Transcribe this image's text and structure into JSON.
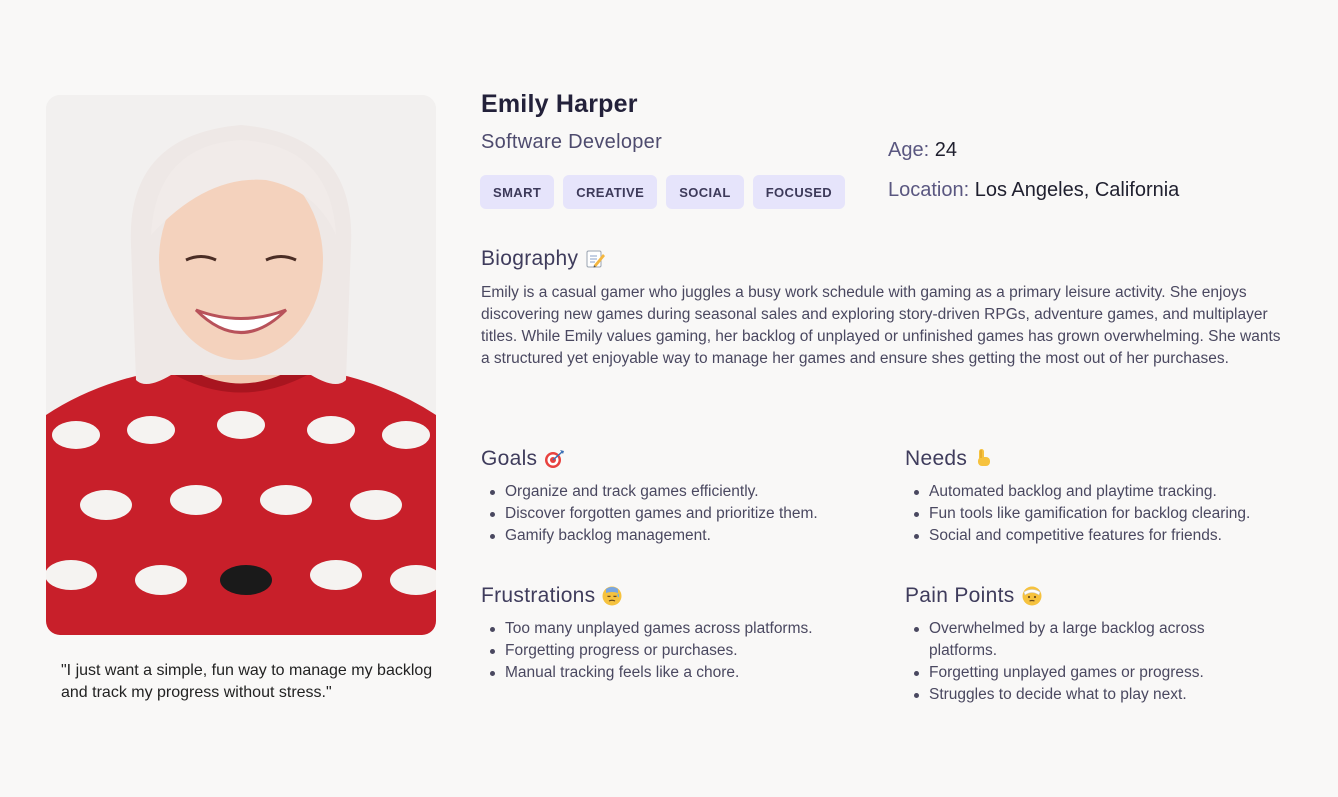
{
  "persona": {
    "name": "Emily Harper",
    "role": "Software Developer",
    "tags": [
      "SMART",
      "CREATIVE",
      "SOCIAL",
      "FOCUSED"
    ],
    "age_label": "Age:",
    "age_value": "24",
    "location_label": "Location:",
    "location_value": "Los Angeles, California",
    "quote": "\"I just want a simple, fun way to manage my backlog and track my progress without stress.\""
  },
  "biography": {
    "title": "Biography",
    "icon": "memo-icon",
    "text": "Emily is a casual gamer who juggles a busy work schedule with gaming as a primary leisure activity. She enjoys discovering new games during seasonal sales and exploring story-driven RPGs, adventure games, and multiplayer titles. While Emily values gaming, her backlog of unplayed or unfinished games has grown overwhelming. She wants a structured yet enjoyable way to manage her games and ensure shes getting the most out of her purchases."
  },
  "goals": {
    "title": "Goals",
    "icon": "target-icon",
    "items": [
      "Organize and track games efficiently.",
      "Discover forgotten games and prioritize them.",
      "Gamify backlog management."
    ]
  },
  "needs": {
    "title": "Needs",
    "icon": "pointing-down-icon",
    "items": [
      "Automated backlog and playtime tracking.",
      "Fun tools like gamification for backlog clearing.",
      "Social and competitive features for friends."
    ]
  },
  "frustrations": {
    "title": "Frustrations",
    "icon": "downcast-sweat-face-icon",
    "items": [
      "Too many unplayed games across platforms.",
      "Forgetting progress or purchases.",
      "Manual tracking feels like a chore."
    ]
  },
  "pain_points": {
    "title": "Pain Points",
    "icon": "face-with-head-bandage-icon",
    "items": [
      "Overwhelmed by a large backlog across platforms.",
      "Forgetting unplayed games or progress.",
      "Struggles to decide what to play next."
    ]
  },
  "colors": {
    "background": "#f9f8f7",
    "tag_background": "#e6e4fb",
    "heading": "#3f3c5c",
    "sweater_red": "#d0202a"
  }
}
